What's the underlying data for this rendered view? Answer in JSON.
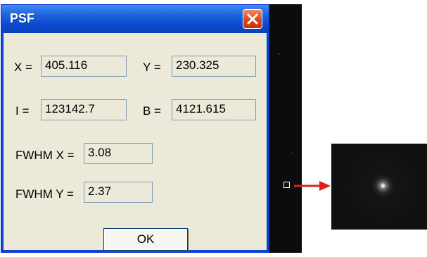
{
  "window": {
    "title": "PSF",
    "accent_color": "#0a49cf",
    "close_color": "#d9451c"
  },
  "fields": {
    "x": {
      "label": "X =",
      "value": "405.116"
    },
    "y": {
      "label": "Y =",
      "value": "230.325"
    },
    "i": {
      "label": "I =",
      "value": "123142.7"
    },
    "b": {
      "label": "B =",
      "value": "4121.615"
    },
    "fwhm_x": {
      "label": "FWHM X =",
      "value": "3.08"
    },
    "fwhm_y": {
      "label": "FWHM Y =",
      "value": "2.37"
    }
  },
  "buttons": {
    "ok_label": "OK"
  },
  "annotation": {
    "arrow_color": "#e02020"
  },
  "icons": {
    "close": "close-icon",
    "marker": "star-marker-icon",
    "arrow": "arrow-right-icon"
  }
}
